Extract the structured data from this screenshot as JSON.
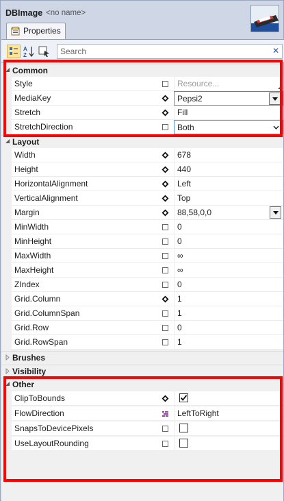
{
  "header": {
    "title": "DBImage",
    "subtitle": "<no name>",
    "tab_label": "Properties"
  },
  "toolbar": {
    "search_placeholder": "Search",
    "clear_glyph": "✕"
  },
  "categories": {
    "common": "Common",
    "layout": "Layout",
    "brushes": "Brushes",
    "visibility": "Visibility",
    "other": "Other"
  },
  "common": [
    {
      "name": "Style",
      "value": "Resource...",
      "marker": "square"
    },
    {
      "name": "MediaKey",
      "value": "Pepsi2",
      "marker": "diamond"
    },
    {
      "name": "Stretch",
      "value": "Fill",
      "marker": "diamond"
    },
    {
      "name": "StretchDirection",
      "value": "Both",
      "marker": "square"
    }
  ],
  "layout": [
    {
      "name": "Width",
      "value": "678",
      "marker": "diamond"
    },
    {
      "name": "Height",
      "value": "440",
      "marker": "diamond"
    },
    {
      "name": "HorizontalAlignment",
      "value": "Left",
      "marker": "diamond"
    },
    {
      "name": "VerticalAlignment",
      "value": "Top",
      "marker": "diamond"
    },
    {
      "name": "Margin",
      "value": "88,58,0,0",
      "marker": "diamond"
    },
    {
      "name": "MinWidth",
      "value": "0",
      "marker": "square"
    },
    {
      "name": "MinHeight",
      "value": "0",
      "marker": "square"
    },
    {
      "name": "MaxWidth",
      "value": "∞",
      "marker": "square"
    },
    {
      "name": "MaxHeight",
      "value": "∞",
      "marker": "square"
    },
    {
      "name": "ZIndex",
      "value": "0",
      "marker": "square"
    },
    {
      "name": "Grid.Column",
      "value": "1",
      "marker": "diamond"
    },
    {
      "name": "Grid.ColumnSpan",
      "value": "1",
      "marker": "square"
    },
    {
      "name": "Grid.Row",
      "value": "0",
      "marker": "square"
    },
    {
      "name": "Grid.RowSpan",
      "value": "1",
      "marker": "square"
    }
  ],
  "other": [
    {
      "name": "ClipToBounds",
      "checked": true,
      "marker": "diamond"
    },
    {
      "name": "FlowDirection",
      "value": "LeftToRight",
      "marker": "resource"
    },
    {
      "name": "SnapsToDevicePixels",
      "checked": false,
      "marker": "square"
    },
    {
      "name": "UseLayoutRounding",
      "checked": false,
      "marker": "square"
    }
  ],
  "colors": {
    "highlight_box": "#ff0000",
    "panel_bg": "#cfd6e5",
    "grid_bg": "#f0f0f0"
  }
}
